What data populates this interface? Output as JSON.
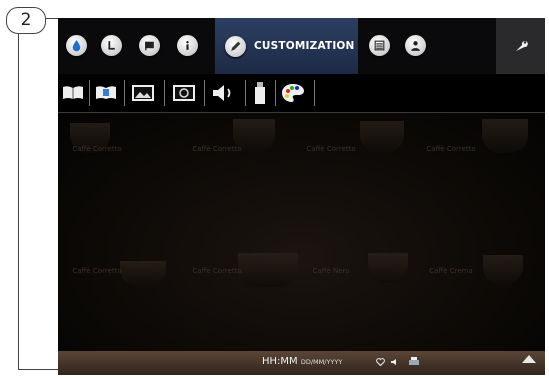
{
  "figure": {
    "step_number": "2"
  },
  "nav": {
    "active_tab_label": "CUSTOMIZATION",
    "tabs": [
      {
        "icon": "drop-icon"
      },
      {
        "icon": "cup-size-icon"
      },
      {
        "icon": "flag-icon"
      },
      {
        "icon": "info-icon"
      },
      {
        "icon": "pencil-icon",
        "label": "CUSTOMIZATION"
      },
      {
        "icon": "list-icon"
      },
      {
        "icon": "user-icon"
      },
      {
        "icon": "wrench-icon"
      }
    ]
  },
  "toolbar": {
    "items": [
      "book-icon",
      "book-open-icon",
      "image-icon",
      "screensaver-icon",
      "speaker-icon",
      "usb-icon",
      "palette-icon"
    ]
  },
  "content": {
    "beverages": [
      "Caffè Corretto",
      "Caffè Corretto",
      "Caffè Corretto",
      "Caffè Corretto",
      "Caffè Corretto",
      "Caffè Corretto",
      "Caffè Nero",
      "Caffè Crema",
      "Caffè Nero"
    ]
  },
  "status": {
    "time_format": "HH:MM",
    "date_format": "DD/MM/YYYY",
    "colors": {
      "active_tab": "#2c3f63",
      "statusbar": "#4a3a2e"
    }
  }
}
